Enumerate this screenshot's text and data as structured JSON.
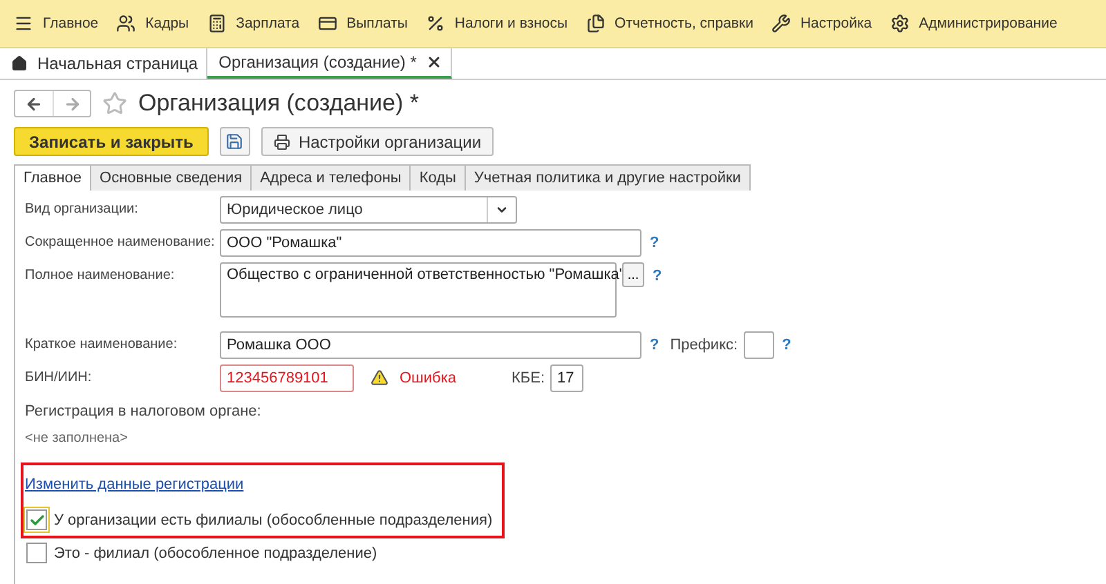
{
  "menu": [
    {
      "label": "Главное"
    },
    {
      "label": "Кадры"
    },
    {
      "label": "Зарплата"
    },
    {
      "label": "Выплаты"
    },
    {
      "label": "Налоги и взносы"
    },
    {
      "label": "Отчетность, справки"
    },
    {
      "label": "Настройка"
    },
    {
      "label": "Администрирование"
    }
  ],
  "window_tabs": [
    {
      "label": "Начальная страница",
      "selected": false,
      "closable": false
    },
    {
      "label": "Организация (создание) *",
      "selected": true,
      "closable": true
    }
  ],
  "form": {
    "title": "Организация (создание) *",
    "starred": false,
    "toolbar": {
      "primary": "Записать и закрыть",
      "settings": "Настройки организации"
    }
  },
  "form_tabs": [
    {
      "label": "Главное",
      "selected": true
    },
    {
      "label": "Основные сведения",
      "selected": false
    },
    {
      "label": "Адреса и телефоны",
      "selected": false
    },
    {
      "label": "Коды",
      "selected": false
    },
    {
      "label": "Учетная политика и другие настройки",
      "selected": false
    }
  ],
  "fields": {
    "org_type": {
      "label": "Вид организации:",
      "value": "Юридическое лицо"
    },
    "short_name": {
      "label": "Сокращенное наименование:",
      "value": "ООО \"Ромашка\"",
      "help": "?"
    },
    "full_name": {
      "label": "Полное наименование:",
      "value": "Общество с ограниченной ответственностью \"Ромашка\"",
      "button": "...",
      "help": "?"
    },
    "brief_name": {
      "label": "Краткое наименование:",
      "value": "Ромашка ООО",
      "help": "?",
      "prefix_label": "Префикс:",
      "prefix_help": "?"
    },
    "bin": {
      "label": "БИН/ИИН:",
      "value": "123456789101",
      "invalid": true,
      "status": "Ошибка",
      "kbe_label": "КБЕ:",
      "kbe_value": "17"
    },
    "registration": {
      "label": "Регистрация в налоговом органе:",
      "value": "<не заполнена>"
    }
  },
  "link": "Изменить данные регистрации",
  "checkboxes": [
    {
      "label": "У организации есть филиалы (обособленные подразделения)",
      "checked": true
    },
    {
      "label": "Это - филиал (обособленное подразделение)",
      "checked": false
    }
  ]
}
